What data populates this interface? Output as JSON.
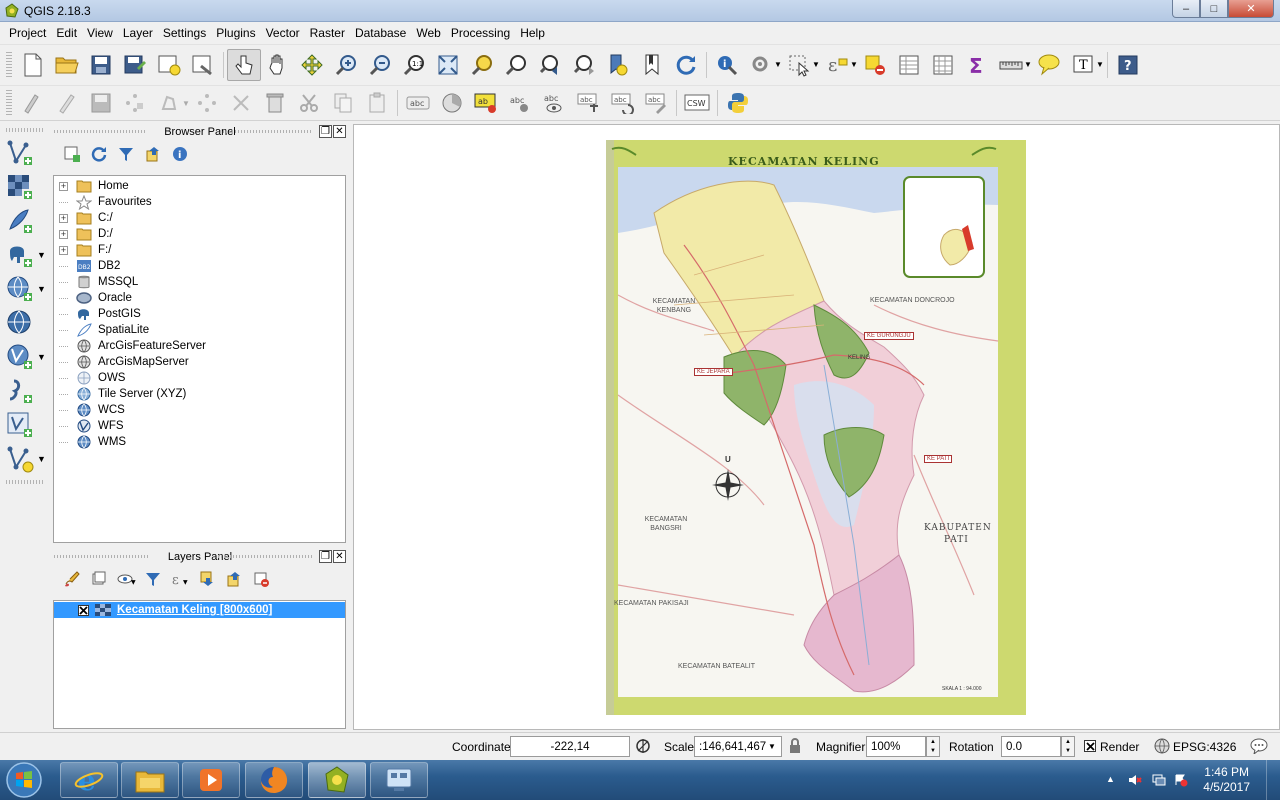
{
  "window": {
    "title": "QGIS 2.18.3",
    "min": "–",
    "max": "□",
    "close": "✕"
  },
  "menu": [
    "Project",
    "Edit",
    "View",
    "Layer",
    "Settings",
    "Plugins",
    "Vector",
    "Raster",
    "Database",
    "Web",
    "Processing",
    "Help"
  ],
  "browser_panel": {
    "title": "Browser Panel",
    "items": [
      {
        "label": "Home",
        "expandable": true,
        "icon": "folder-icon"
      },
      {
        "label": "Favourites",
        "expandable": false,
        "icon": "star-icon"
      },
      {
        "label": "C:/",
        "expandable": true,
        "icon": "folder-icon"
      },
      {
        "label": "D:/",
        "expandable": true,
        "icon": "folder-icon"
      },
      {
        "label": "F:/",
        "expandable": true,
        "icon": "folder-icon"
      },
      {
        "label": "DB2",
        "expandable": false,
        "icon": "db2-icon"
      },
      {
        "label": "MSSQL",
        "expandable": false,
        "icon": "mssql-icon"
      },
      {
        "label": "Oracle",
        "expandable": false,
        "icon": "oracle-icon"
      },
      {
        "label": "PostGIS",
        "expandable": false,
        "icon": "postgis-icon"
      },
      {
        "label": "SpatiaLite",
        "expandable": false,
        "icon": "spatialite-icon"
      },
      {
        "label": "ArcGisFeatureServer",
        "expandable": false,
        "icon": "arcgis-icon"
      },
      {
        "label": "ArcGisMapServer",
        "expandable": false,
        "icon": "arcgis-icon"
      },
      {
        "label": "OWS",
        "expandable": false,
        "icon": "ows-icon"
      },
      {
        "label": "Tile Server (XYZ)",
        "expandable": false,
        "icon": "tile-server-icon"
      },
      {
        "label": "WCS",
        "expandable": false,
        "icon": "wcs-icon"
      },
      {
        "label": "WFS",
        "expandable": false,
        "icon": "wfs-icon"
      },
      {
        "label": "WMS",
        "expandable": false,
        "icon": "wms-icon"
      }
    ]
  },
  "layers_panel": {
    "title": "Layers Panel",
    "layers": [
      {
        "label": "Kecamatan Keling [800x600]",
        "checked": true
      }
    ]
  },
  "map": {
    "title": "KECAMATAN KELING",
    "labels": {
      "kembang": "KECAMATAN KENBANG",
      "doncrojo": "KECAMATAN DONCROJO",
      "bangsri": "KECAMATAN BANGSRI",
      "pati_1": "KABUPATEN",
      "pati_2": "PATI",
      "pakisaji": "KECAMATAN PAKISAJI",
      "batealit": "KECAMATAN BATEALIT",
      "ke_jepara": "KE JEPARA",
      "ke_pati": "KE PATI",
      "ke_gunung": "KE GURUNGJU",
      "kelurah": "KELING",
      "north": "U",
      "scale": "SKALA 1 : 94.000"
    }
  },
  "status": {
    "coordinate_label": "Coordinate",
    "coordinate_value": "-222,14",
    "scale_label": "Scale",
    "scale_value": ":146,641,467",
    "magnifier_label": "Magnifier",
    "magnifier_value": "100%",
    "rotation_label": "Rotation",
    "rotation_value": "0.0",
    "render_label": "Render",
    "render_checked": true,
    "crs": "EPSG:4326"
  },
  "taskbar": {
    "time": "1:46 PM",
    "date": "4/5/2017"
  },
  "colors": {
    "selection": "#3399ff",
    "map_border_green": "#cdd96f",
    "map_yellow": "#f2eaa8",
    "map_pink": "#e6b8cf",
    "map_green": "#8fb46a",
    "map_blue": "#c9d8ee"
  }
}
